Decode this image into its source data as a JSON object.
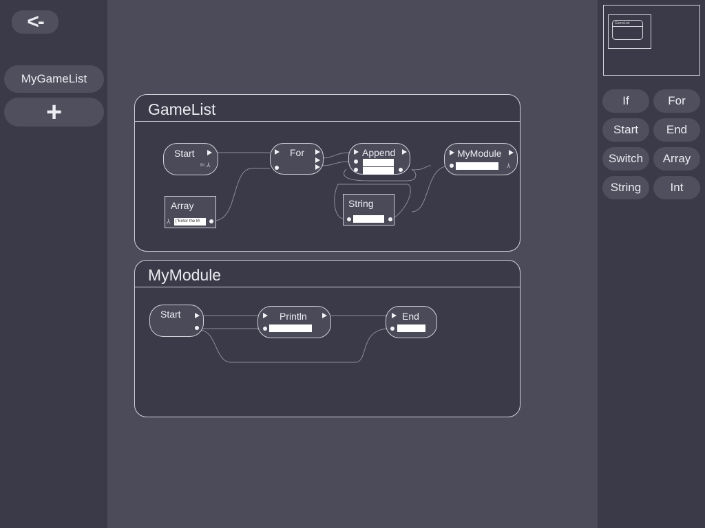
{
  "sidebar": {
    "back_label": "<-",
    "modules": [
      "MyGameList"
    ],
    "add_label": "+"
  },
  "minimap": {
    "node_title": "GameList"
  },
  "palette": {
    "items": [
      "If",
      "For",
      "Start",
      "End",
      "Switch",
      "Array",
      "String",
      "Int"
    ]
  },
  "panels": {
    "gamelist": {
      "title": "GameList",
      "nodes": {
        "start": {
          "title": "Start",
          "port_label": "In"
        },
        "for": {
          "title": "For"
        },
        "append": {
          "title": "Append"
        },
        "mymodule": {
          "title": "MyModule"
        },
        "array": {
          "title": "Array",
          "field_value": "[\"Enter the M"
        },
        "string": {
          "title": "String"
        }
      }
    },
    "mymodule": {
      "title": "MyModule",
      "nodes": {
        "start": {
          "title": "Start"
        },
        "println": {
          "title": "Println"
        },
        "end": {
          "title": "End"
        }
      }
    }
  },
  "colors": {
    "background": "#4b4b5a",
    "sidebar": "#3a3a48",
    "panel": "#3a3a48",
    "node": "#4a4a59",
    "line": "#d3d3dc"
  }
}
